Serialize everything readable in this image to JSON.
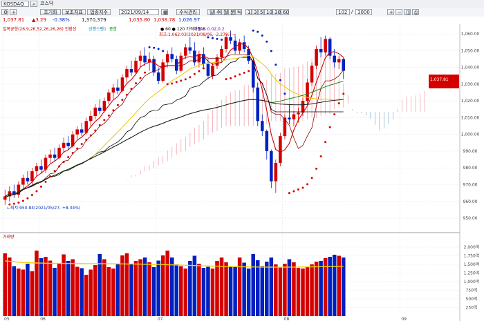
{
  "toolbar": {
    "symbol": "KOSDAQ",
    "market_name": "코스닥",
    "buttons": [
      "초기화",
      "보조지표",
      "업종지수",
      "수식관리"
    ],
    "period_buttons": [
      "일",
      "주",
      "월",
      "분",
      "틱"
    ],
    "interval_buttons": [
      "1",
      "3",
      "5",
      "10",
      "30",
      "60"
    ],
    "date": "2021/09/14",
    "count": "102",
    "total": "3000"
  },
  "quote": {
    "price": "1,037.81",
    "change": "▲3.29",
    "change_pct": "-0.38%",
    "volume": "1,370,379",
    "open": "1,035.80",
    "high": "1,038.78",
    "low": "1,026.97"
  },
  "legend": {
    "ichimoku": "일목균형(26,9,26,52,26,26,26) 전환선",
    "leading": "선행스팬1",
    "ma": "● 60 ● 120 가격이동 5",
    "psar": "PSAR 0.02,0.2",
    "price_ma_label": "종합",
    "high_note": "최고:1,062.03(2021/08/06, -2.27%) →",
    "low_note": "←최저:950.84(2021/05/27, +8.34%)"
  },
  "volume_panel": {
    "label": "거래량",
    "ylabels": [
      "2,000억",
      "1,750억",
      "1,500억",
      "1,250억",
      "1,000억",
      "750억",
      "500억",
      "250억"
    ]
  },
  "chart_data": [
    {
      "type": "candlestick",
      "xlabels": [
        "05",
        "06",
        "07",
        "08",
        "09",
        "10"
      ],
      "ylabels": [
        "1,060.00",
        "1,050.00",
        "1,040.00",
        "1,030.00",
        "1,020.00",
        "1,010.00",
        "1,000.00",
        "990.00",
        "980.00",
        "970.00",
        "960.00",
        "950.00"
      ],
      "ylim": [
        943,
        1065
      ],
      "current_price": "1,037.81",
      "candles": [
        [
          961,
          967,
          958,
          963
        ],
        [
          963,
          969,
          960,
          966
        ],
        [
          966,
          970,
          962,
          964
        ],
        [
          964,
          972,
          962,
          970
        ],
        [
          970,
          976,
          968,
          974
        ],
        [
          974,
          978,
          970,
          972
        ],
        [
          972,
          980,
          970,
          978
        ],
        [
          978,
          983,
          975,
          981
        ],
        [
          981,
          985,
          977,
          979
        ],
        [
          979,
          988,
          977,
          986
        ],
        [
          986,
          991,
          983,
          988
        ],
        [
          988,
          992,
          984,
          986
        ],
        [
          986,
          994,
          985,
          992
        ],
        [
          992,
          998,
          989,
          995
        ],
        [
          995,
          999,
          991,
          993
        ],
        [
          993,
          1002,
          992,
          1000
        ],
        [
          1000,
          1005,
          997,
          1003
        ],
        [
          1003,
          1007,
          999,
          1001
        ],
        [
          1001,
          1010,
          1000,
          1008
        ],
        [
          1008,
          1014,
          1005,
          1011
        ],
        [
          1011,
          1018,
          1009,
          1016
        ],
        [
          1016,
          1021,
          1012,
          1014
        ],
        [
          1014,
          1022,
          1013,
          1020
        ],
        [
          1020,
          1027,
          1018,
          1025
        ],
        [
          1025,
          1030,
          1021,
          1028
        ],
        [
          1028,
          1033,
          1024,
          1026
        ],
        [
          1026,
          1036,
          1025,
          1034
        ],
        [
          1034,
          1041,
          1031,
          1039
        ],
        [
          1039,
          1044,
          1035,
          1037
        ],
        [
          1037,
          1046,
          1036,
          1044
        ],
        [
          1044,
          1050,
          1040,
          1047
        ],
        [
          1047,
          1052,
          1041,
          1043
        ],
        [
          1043,
          1049,
          1038,
          1045
        ],
        [
          1045,
          1047,
          1035,
          1037
        ],
        [
          1037,
          1040,
          1030,
          1032
        ],
        [
          1032,
          1045,
          1031,
          1043
        ],
        [
          1043,
          1050,
          1040,
          1048
        ],
        [
          1048,
          1052,
          1043,
          1045
        ],
        [
          1045,
          1047,
          1036,
          1038
        ],
        [
          1038,
          1049,
          1037,
          1047
        ],
        [
          1047,
          1054,
          1045,
          1052
        ],
        [
          1052,
          1058,
          1048,
          1050
        ],
        [
          1050,
          1055,
          1041,
          1043
        ],
        [
          1043,
          1050,
          1040,
          1048
        ],
        [
          1048,
          1052,
          1040,
          1042
        ],
        [
          1042,
          1045,
          1033,
          1035
        ],
        [
          1035,
          1043,
          1033,
          1041
        ],
        [
          1041,
          1048,
          1039,
          1046
        ],
        [
          1046,
          1053,
          1043,
          1051
        ],
        [
          1051,
          1060,
          1049,
          1058
        ],
        [
          1058,
          1062,
          1054,
          1056
        ],
        [
          1056,
          1059,
          1048,
          1050
        ],
        [
          1050,
          1057,
          1048,
          1055
        ],
        [
          1055,
          1059,
          1049,
          1051
        ],
        [
          1051,
          1053,
          1042,
          1044
        ],
        [
          1044,
          1046,
          1025,
          1028
        ],
        [
          1028,
          1031,
          1005,
          1008
        ],
        [
          1008,
          1012,
          999,
          1002
        ],
        [
          1002,
          1003,
          985,
          990
        ],
        [
          990,
          991,
          968,
          972
        ],
        [
          972,
          985,
          965,
          983
        ],
        [
          983,
          1001,
          981,
          999
        ],
        [
          999,
          1012,
          997,
          1010
        ],
        [
          1010,
          1018,
          1006,
          1009
        ],
        [
          1009,
          1014,
          1005,
          1012
        ],
        [
          1012,
          1016,
          1007,
          1013
        ],
        [
          1013,
          1022,
          1011,
          1020
        ],
        [
          1020,
          1033,
          1018,
          1031
        ],
        [
          1031,
          1043,
          1029,
          1041
        ],
        [
          1041,
          1053,
          1039,
          1051
        ],
        [
          1051,
          1058,
          1046,
          1049
        ],
        [
          1049,
          1059,
          1047,
          1057
        ],
        [
          1057,
          1058,
          1045,
          1047
        ],
        [
          1047,
          1051,
          1040,
          1043
        ],
        [
          1043,
          1047,
          1039,
          1045
        ],
        [
          1045,
          1046,
          1033,
          1038
        ]
      ]
    },
    {
      "type": "bar",
      "title": "거래량",
      "ylim": [
        0,
        2100
      ],
      "values": [
        1820,
        1700,
        1450,
        1380,
        1350,
        1520,
        1300,
        1900,
        1680,
        1720,
        1610,
        1400,
        1520,
        1790,
        1600,
        1650,
        1430,
        1390,
        1200,
        1350,
        1480,
        1800,
        1650,
        1420,
        1380,
        1500,
        1760,
        1820,
        1500,
        1600,
        1650,
        1700,
        1560,
        1420,
        1610,
        1760,
        1900,
        1700,
        1500,
        1450,
        1380,
        1600,
        1750,
        1520,
        1400,
        1430,
        1380,
        1600,
        1700,
        1560,
        1430,
        1450,
        1700,
        1550,
        1380,
        1800,
        1620,
        1450,
        1580,
        1700,
        1500,
        1430,
        1520,
        1650,
        1560,
        1400,
        1380,
        1420,
        1500,
        1580,
        1600,
        1680,
        1720,
        1780,
        1750,
        1700
      ],
      "ma_values": [
        1600,
        1590,
        1580,
        1565,
        1555,
        1550,
        1545,
        1540,
        1538,
        1535,
        1533,
        1530,
        1528,
        1527,
        1526,
        1525,
        1524,
        1524,
        1523,
        1522,
        1520,
        1520,
        1519,
        1518,
        1517,
        1515,
        1514,
        1513,
        1512,
        1510,
        1508,
        1505,
        1502,
        1500,
        1497,
        1494,
        1490,
        1486,
        1482,
        1478,
        1474,
        1470,
        1466,
        1462,
        1458,
        1455,
        1452,
        1448,
        1445,
        1442,
        1439,
        1436,
        1433,
        1430,
        1428,
        1426,
        1424,
        1422,
        1421,
        1420,
        1420,
        1420,
        1420,
        1421,
        1422,
        1424,
        1426,
        1428,
        1430,
        1432,
        1434,
        1436,
        1438,
        1440,
        1441,
        1442
      ]
    }
  ]
}
